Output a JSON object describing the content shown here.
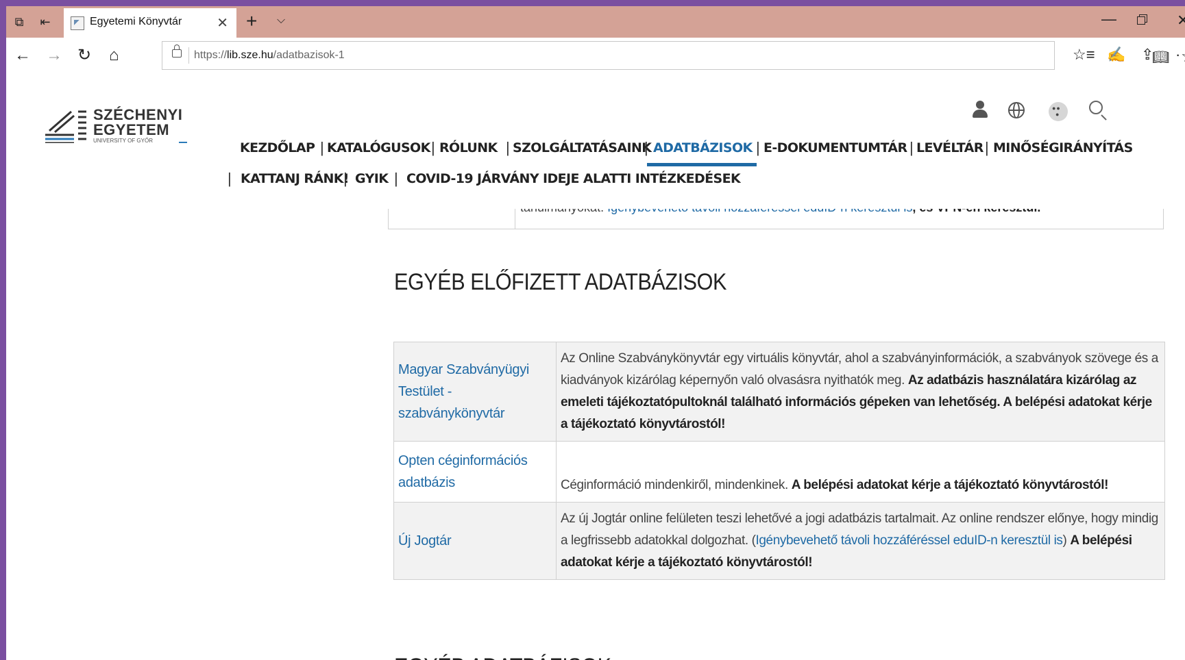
{
  "browser": {
    "tab_title": "Egyetemi Könyvtár",
    "url_prefix": "https://",
    "url_host": "lib.sze.hu",
    "url_path": "/adatbazisok-1"
  },
  "site": {
    "logo_line1": "SZÉCHENYI",
    "logo_line2": "EGYETEM",
    "logo_line3": "UNIVERSITY OF GYŐR",
    "menu_row1": [
      "KEZDŐLAP",
      "KATALÓGUSOK",
      "RÓLUNK",
      "SZOLGÁLTATÁSAINK",
      "ADATBÁZISOK",
      "E-DOKUMENTUMTÁR",
      "LEVÉLTÁR",
      "MINŐSÉGIRÁNYÍTÁS"
    ],
    "menu_row2": [
      "KATTANJ RÁNK!",
      "GYIK",
      "COVID-19 JÁRVÁNY IDEJE ALATTI INTÉZKEDÉSEK"
    ],
    "active_menu": "ADATBÁZISOK",
    "accent_color": "#1f6aa5"
  },
  "prev_row": {
    "text_start": "tanulmányokat. ",
    "link": "Igénybevehető távoli hozzáféréssel eduID-n keresztül is",
    "text_end_bold": ", és VPN-en keresztül."
  },
  "section_title": "EGYÉB ELŐFIZETT ADATBÁZISOK",
  "section_title_next": "EGYÉB ADATBÁZISOK",
  "databases": [
    {
      "name": "Magyar Szabványügyi Testület - szabványkönyvtár",
      "text": "Az Online Szabványkönyvtár egy virtuális könyvtár, ahol a szabványinformációk, a szabványok szövege és a kiadványok kizárólag képernyőn való olvasásra nyithatók meg. ",
      "bold": "Az adatbázis használatára kizárólag az emeleti tájékoztatópultoknál található információs gépeken van lehetőség. A belépési adatokat kérje a tájékoztató könyvtárostól!"
    },
    {
      "name": "Opten céginformációs adatbázis",
      "text": "Céginformáció mindenkiről, mindenkinek. ",
      "bold": "A belépési adatokat kérje a tájékoztató könyvtárostól!"
    },
    {
      "name": "Új Jogtár",
      "text": " Az új Jogtár online felületen teszi lehetővé a jogi adatbázis tartalmait. Az online rendszer előnye, hogy mindig a legfrissebb adatokkal dolgozhat. (",
      "link": "Igénybevehető távoli hozzáféréssel eduID-n keresztül is",
      "after_link": ") ",
      "bold": "A belépési adatokat kérje a tájékoztató könyvtárostól!"
    }
  ]
}
